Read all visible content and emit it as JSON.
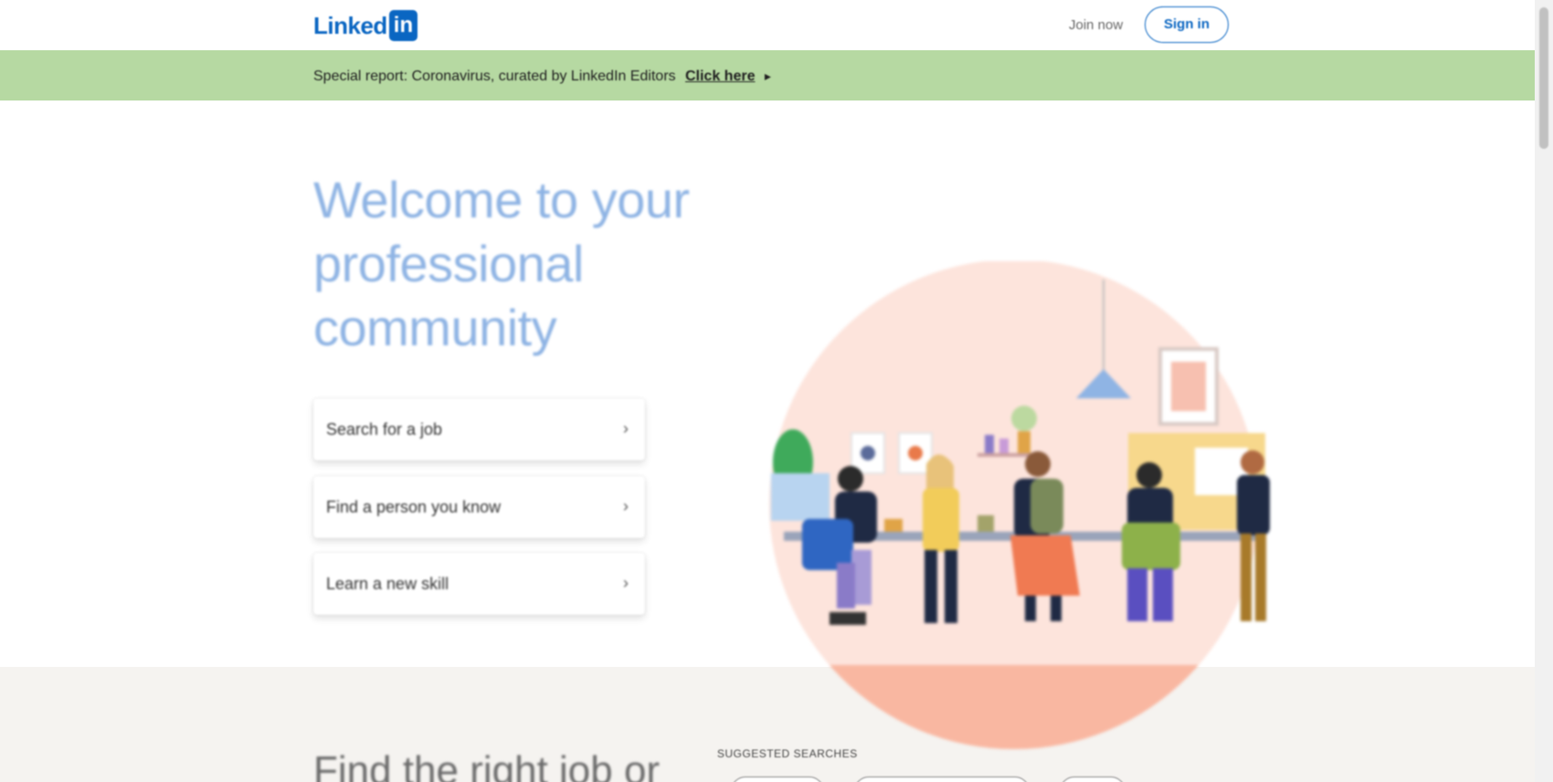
{
  "header": {
    "logo_text": "Linked",
    "logo_in": "in",
    "join_label": "Join now",
    "signin_label": "Sign in"
  },
  "banner": {
    "text": "Special report: Coronavirus, curated by LinkedIn Editors",
    "link_label": "Click here",
    "arrow": "▸",
    "color": "#b6d9a2"
  },
  "hero": {
    "title": "Welcome to your professional community",
    "options": [
      {
        "label": "Search for a job",
        "chevron": "›"
      },
      {
        "label": "Find a person you know",
        "chevron": "›"
      },
      {
        "label": "Learn a new skill",
        "chevron": "›"
      }
    ]
  },
  "bottom": {
    "title": "Find the right job or",
    "suggested_label": "SUGGESTED SEARCHES"
  },
  "colors": {
    "brand": "#0a66c2",
    "hero_title": "#8fb4e4",
    "illustration_circle": "#fde4dc",
    "illustration_floor": "#f9b7a1"
  }
}
